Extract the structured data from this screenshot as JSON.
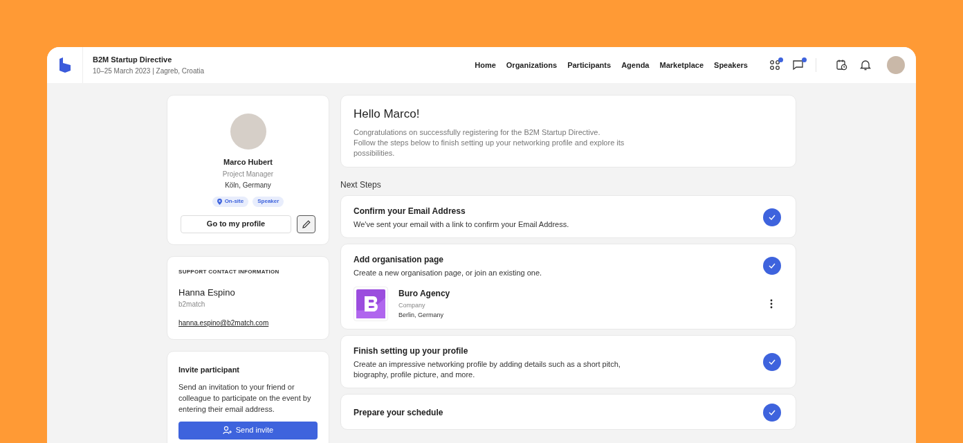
{
  "event": {
    "title": "B2M Startup Directive",
    "subtitle": "10–25 March 2023 | Zagreb, Croatia"
  },
  "nav": [
    "Home",
    "Organizations",
    "Participants",
    "Agenda",
    "Marketplace",
    "Speakers"
  ],
  "header_icons": [
    {
      "kind": "apps",
      "dot": true
    },
    {
      "kind": "chat",
      "dot": true
    },
    {
      "kind": "calendar",
      "dot": false
    },
    {
      "kind": "bell",
      "dot": false
    }
  ],
  "profile": {
    "name": "Marco Hubert",
    "role": "Project Manager",
    "location": "Köln, Germany",
    "tags": [
      {
        "kind": "location",
        "label": "On-site"
      },
      {
        "kind": "plain",
        "label": "Speaker"
      }
    ],
    "button": "Go to my profile"
  },
  "support": {
    "heading": "SUPPORT CONTACT INFORMATION",
    "name": "Hanna Espino",
    "company": "b2match",
    "email": "hanna.espino@b2match.com"
  },
  "invite": {
    "title": "Invite participant",
    "text": "Send an invitation to your friend or colleague to participate on the event by entering their email address.",
    "button": "Send invite"
  },
  "welcome": {
    "title": "Hello Marco!",
    "lines": [
      "Congratulations on successfully registering for the B2M Startup Directive.",
      "Follow the steps below to finish setting up your networking profile and explore its possibilities."
    ]
  },
  "next_steps_label": "Next Steps",
  "steps": [
    {
      "title": "Confirm your Email Address",
      "text": "We've sent your email with a link to confirm your Email Address.",
      "completed": true
    },
    {
      "title": "Add organisation page",
      "text": "Create a new organisation page, or join an existing one.",
      "completed": true,
      "organization": {
        "name": "Buro Agency",
        "type": "Company",
        "location": "Berlin, Germany"
      }
    },
    {
      "title": "Finish setting up your profile",
      "text": "Create an impressive networking profile by adding details such as a short pitch, biography, profile picture, and more.",
      "completed": true
    },
    {
      "title": "Prepare your schedule",
      "completed": true
    }
  ]
}
